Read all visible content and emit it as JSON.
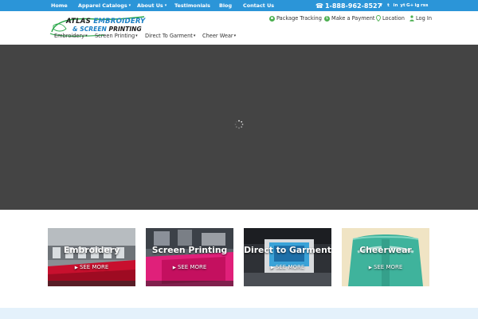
{
  "topbar": {
    "nav": [
      {
        "label": "Home",
        "dropdown": false
      },
      {
        "label": "Apparel Catalogs",
        "dropdown": true
      },
      {
        "label": "About Us",
        "dropdown": true
      },
      {
        "label": "Testimonials",
        "dropdown": false
      },
      {
        "label": "Blog",
        "dropdown": false
      },
      {
        "label": "Contact Us",
        "dropdown": false
      }
    ],
    "phone": "1-888-962-8527",
    "socials": [
      "f",
      "t",
      "in",
      "yt",
      "G+",
      "ig",
      "rss"
    ]
  },
  "logo": {
    "line1_dark": "ATLAS",
    "line1_blue": "EMBROIDERY",
    "line2_blue": "& SCREEN",
    "line2_dark": "PRINTING"
  },
  "main_nav": [
    {
      "label": "Embroidery",
      "dropdown": true
    },
    {
      "label": "Screen Printing",
      "dropdown": true
    },
    {
      "label": "Direct To Garment",
      "dropdown": true
    },
    {
      "label": "Cheer Wear",
      "dropdown": true
    }
  ],
  "utility": [
    {
      "label": "Package Tracking",
      "icon": "package-icon"
    },
    {
      "label": "Make a Payment",
      "icon": "dollar-icon"
    },
    {
      "label": "Location",
      "icon": "location-pin-icon"
    },
    {
      "label": "Log In",
      "icon": "user-icon"
    }
  ],
  "tiles": [
    {
      "title": "Embroidery",
      "more": "SEE MORE"
    },
    {
      "title": "Screen Printing",
      "more": "SEE MORE"
    },
    {
      "title": "Direct to Garment",
      "more": "SEE MORE"
    },
    {
      "title": "Cheerwear",
      "more": "SEE MORE"
    }
  ],
  "colors": {
    "topbar": "#2b95d8",
    "hero": "#444444",
    "accent_green": "#4caf50",
    "bottom_strip": "#e4f1fb"
  }
}
